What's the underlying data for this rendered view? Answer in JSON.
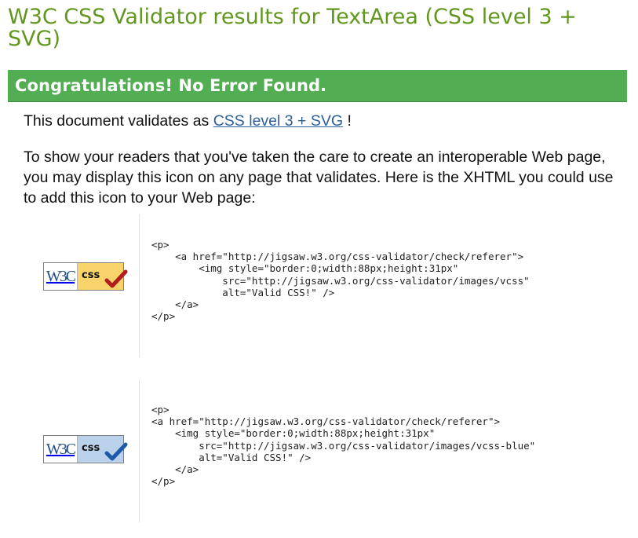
{
  "page": {
    "title": "W3C CSS Validator results for TextArea (CSS level 3 + SVG)"
  },
  "banner": {
    "text": "Congratulations! No Error Found."
  },
  "validation": {
    "prefix": "This document validates as",
    "link_text": "CSS level 3 + SVG",
    "suffix": "!"
  },
  "intro": {
    "text": "To show your readers that you've taken the care to create an interoperable Web page, you may display this icon on any page that validates. Here is the XHTML you could use to add this icon to your Web page:"
  },
  "examples": [
    {
      "badge": {
        "w3c": "W3C",
        "css": "css",
        "style": "gold",
        "check_color": "#b21d1d"
      },
      "code": "<p>\n    <a href=\"http://jigsaw.w3.org/css-validator/check/referer\">\n        <img style=\"border:0;width:88px;height:31px\"\n            src=\"http://jigsaw.w3.org/css-validator/images/vcss\"\n            alt=\"Valid CSS!\" />\n    </a>\n</p>"
    },
    {
      "badge": {
        "w3c": "W3C",
        "css": "css",
        "style": "blue",
        "check_color": "#1d5aa8"
      },
      "code": "<p>\n<a href=\"http://jigsaw.w3.org/css-validator/check/referer\">\n    <img style=\"border:0;width:88px;height:31px\"\n        src=\"http://jigsaw.w3.org/css-validator/images/vcss-blue\"\n        alt=\"Valid CSS!\" />\n    </a>\n</p>"
    }
  ],
  "colors": {
    "title": "#61971f",
    "banner_bg": "#52ad53",
    "link": "#2a5f9a"
  }
}
